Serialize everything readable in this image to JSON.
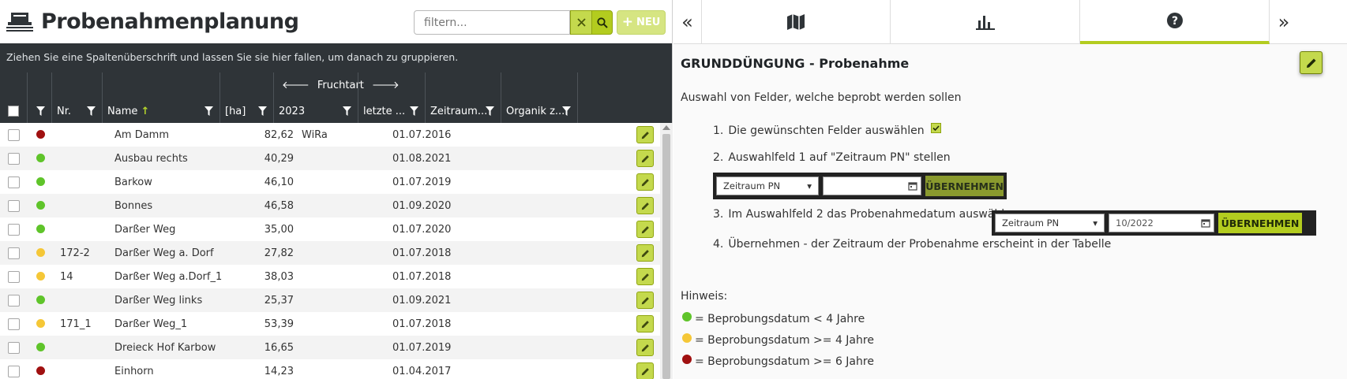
{
  "app": {
    "title": "Probenahmenplanung"
  },
  "toolbar": {
    "filter_placeholder": "filtern...",
    "clear_icon": "close-icon",
    "search_icon": "search-icon",
    "new_label": "NEU"
  },
  "grid": {
    "group_hint": "Ziehen Sie eine Spaltenüberschrift und lassen Sie sie hier fallen, um danach zu gruppieren.",
    "columns": {
      "nr": "Nr.",
      "name": "Name",
      "ha": "[ha]",
      "fruchtart_group": "Fruchtart",
      "year": "2023",
      "letzte": "letzte ...",
      "zeitraum": "Zeitraum...",
      "organik": "Organik z..."
    },
    "rows": [
      {
        "status": "red",
        "nr": "",
        "name": "Am Damm",
        "ha": "82,62",
        "frucht": "WiRa",
        "letzte": "01.07.2016"
      },
      {
        "status": "green",
        "nr": "",
        "name": "Ausbau rechts",
        "ha": "40,29",
        "frucht": "",
        "letzte": "01.08.2021"
      },
      {
        "status": "green",
        "nr": "",
        "name": "Barkow",
        "ha": "46,10",
        "frucht": "",
        "letzte": "01.07.2019"
      },
      {
        "status": "green",
        "nr": "",
        "name": "Bonnes",
        "ha": "46,58",
        "frucht": "",
        "letzte": "01.09.2020"
      },
      {
        "status": "green",
        "nr": "",
        "name": "Darßer Weg",
        "ha": "35,00",
        "frucht": "",
        "letzte": "01.07.2020"
      },
      {
        "status": "yellow",
        "nr": "172-2",
        "name": "Darßer Weg a. Dorf",
        "ha": "27,82",
        "frucht": "",
        "letzte": "01.07.2018"
      },
      {
        "status": "yellow",
        "nr": "14",
        "name": "Darßer Weg a.Dorf_1",
        "ha": "38,03",
        "frucht": "",
        "letzte": "01.07.2018"
      },
      {
        "status": "green",
        "nr": "",
        "name": "Darßer Weg links",
        "ha": "25,37",
        "frucht": "",
        "letzte": "01.09.2021"
      },
      {
        "status": "yellow",
        "nr": "171_1",
        "name": "Darßer Weg_1",
        "ha": "53,39",
        "frucht": "",
        "letzte": "01.07.2018"
      },
      {
        "status": "green",
        "nr": "",
        "name": "Dreieck Hof Karbow",
        "ha": "16,65",
        "frucht": "",
        "letzte": "01.07.2019"
      },
      {
        "status": "red",
        "nr": "",
        "name": "Einhorn",
        "ha": "14,23",
        "frucht": "",
        "letzte": "01.04.2017"
      }
    ]
  },
  "colors": {
    "red": "#a01010",
    "green": "#5fc42a",
    "yellow": "#f5c737",
    "accent": "#b3cc1f",
    "header_dark": "#2f3438"
  },
  "tabs": {
    "collapse_left": "«",
    "expand_right": "»",
    "items": [
      {
        "icon": "map-icon"
      },
      {
        "icon": "bar-chart-icon"
      },
      {
        "icon": "help-icon",
        "active": true
      }
    ]
  },
  "help": {
    "title": "GRUNDDÜNGUNG - Probenahme",
    "intro": "Auswahl von Felder, welche beprobt werden sollen",
    "steps": [
      {
        "num": "1.",
        "text": "Die gewünschten Felder auswählen"
      },
      {
        "num": "2.",
        "text": "Auswahlfeld 1 auf \"Zeitraum PN\" stellen"
      },
      {
        "num": "3.",
        "text": "Im Auswahlfeld 2 das Probenahmedatum auswählen"
      },
      {
        "num": "4.",
        "text": "Übernehmen - der Zeitraum der Probenahme erscheint in der Tabelle"
      }
    ],
    "mock1": {
      "select": "Zeitraum PN",
      "date": "",
      "button": "ÜBERNEHMEN"
    },
    "mock2": {
      "select": "Zeitraum PN",
      "date": "10/2022",
      "button": "ÜBERNEHMEN"
    },
    "hint_label": "Hinweis:",
    "hints": [
      {
        "color": "green",
        "text": "= Beprobungsdatum < 4 Jahre"
      },
      {
        "color": "yellow",
        "text": "= Beprobungsdatum >= 4 Jahre"
      },
      {
        "color": "red",
        "text": "= Beprobungsdatum >= 6 Jahre"
      }
    ]
  }
}
